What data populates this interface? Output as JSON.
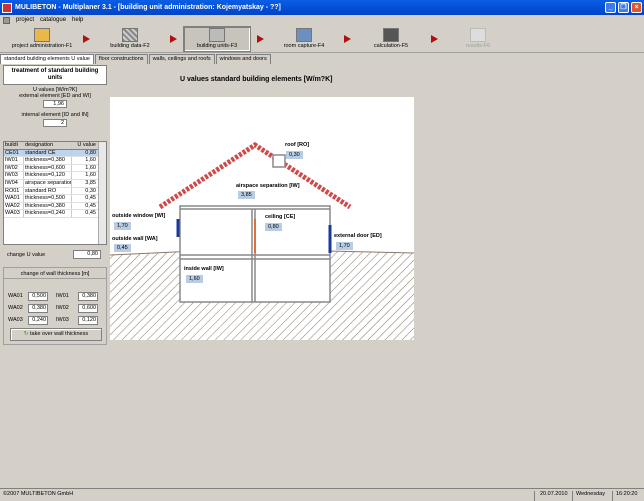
{
  "window": {
    "title": "MULIBETON - Multiplaner 3.1 - [building unit administration: Kojemyatskay - ??]"
  },
  "menu": {
    "items": [
      "project",
      "catalogue",
      "help"
    ]
  },
  "toolbar": {
    "buttons": [
      {
        "label": "project administration-F1",
        "icon": "folder-icon"
      },
      {
        "label": "building data-F2",
        "icon": "building-data-icon"
      },
      {
        "label": "building units-F3",
        "icon": "building-units-icon"
      },
      {
        "label": "room capture-F4",
        "icon": "room-capture-icon"
      },
      {
        "label": "calculation-F5",
        "icon": "calculator-icon"
      },
      {
        "label": "results-F6",
        "icon": "results-icon"
      }
    ]
  },
  "tabs": [
    "standard building elements U value",
    "floor constructions",
    "walls, ceilings and roofs",
    "windows and doors"
  ],
  "left": {
    "title": "treatment of standard building units",
    "u_values_label": "U values [W/m?K]",
    "external_label": "external element [ED and WI]",
    "external_value": "1,96",
    "internal_label": "internal element [ID and IN]",
    "internal_value": "2",
    "table": {
      "headers": [
        "buildi",
        "designation",
        "U value"
      ],
      "rows": [
        [
          "CE01",
          "standard CE",
          "0,80"
        ],
        [
          "IW01",
          "thickness=0,380",
          "1,60"
        ],
        [
          "IW02",
          "thickness=0,600",
          "1,60"
        ],
        [
          "IW03",
          "thickness=0,120",
          "1,60"
        ],
        [
          "IW04",
          "airspace separation",
          "3,85"
        ],
        [
          "RO01",
          "standard RO",
          "0,30"
        ],
        [
          "WA01",
          "thickness=0,500",
          "0,45"
        ],
        [
          "WA02",
          "thickness=0,380",
          "0,45"
        ],
        [
          "WA03",
          "thickness=0,240",
          "0,45"
        ]
      ]
    },
    "change_u_label": "change U value",
    "change_u_value": "0,80",
    "wall_title": "change of wall thickness [m]",
    "wall_rows": [
      {
        "a": "WA01",
        "av": "0,500",
        "b": "IW01",
        "bv": "0,380"
      },
      {
        "a": "WA02",
        "av": "0,380",
        "b": "IW02",
        "bv": "0,600"
      },
      {
        "a": "WA03",
        "av": "0,240",
        "b": "IW03",
        "bv": "0,120"
      }
    ],
    "takeover_label": "take over wall thickness"
  },
  "main": {
    "title": "U values standard building elements [W/m?K]",
    "labels": {
      "roof": "roof [RO]",
      "roof_v": "0,30",
      "airspace": "airspace separation [IW]",
      "airspace_v": "3,85",
      "ceiling": "ceiling [CE]",
      "ceiling_v": "0,80",
      "outside_window": "outside window [WI]",
      "outside_window_v": "1,70",
      "outside_wall": "outside wall [WA]",
      "outside_wall_v": "0,45",
      "external_door": "external door [ED]",
      "external_door_v": "1,70",
      "inside_wall": "inside wall [IW]",
      "inside_wall_v": "1,60"
    }
  },
  "status": {
    "copyright": "©2007 MULTIBETON GmbH",
    "date": "20.07.2010",
    "day": "Wednesday",
    "time": "16:20:20"
  }
}
